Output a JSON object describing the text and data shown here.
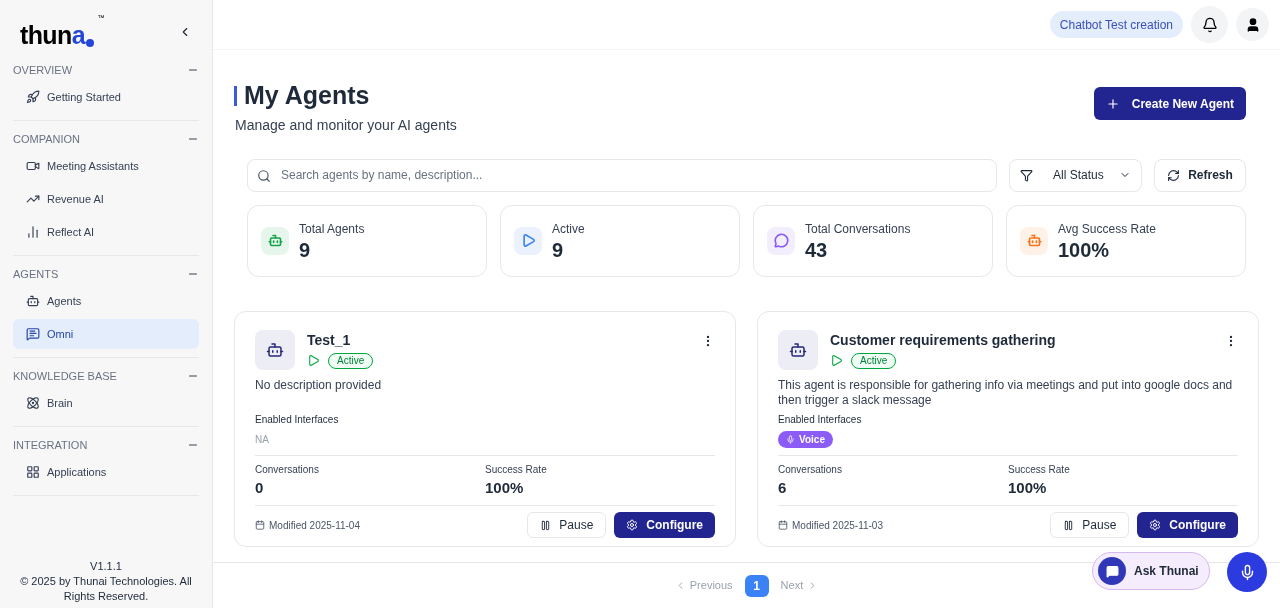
{
  "sidebar": {
    "logo": {
      "text": "thun",
      "accent": "a",
      "tm": "™"
    },
    "sections": [
      {
        "title": "OVERVIEW",
        "items": [
          {
            "label": "Getting Started",
            "kind": "rocket",
            "selected": false
          }
        ]
      },
      {
        "title": "COMPANION",
        "items": [
          {
            "label": "Meeting Assistants",
            "kind": "video",
            "selected": false
          },
          {
            "label": "Revenue AI",
            "kind": "trend",
            "selected": false
          },
          {
            "label": "Reflect AI",
            "kind": "chart",
            "selected": false
          }
        ]
      },
      {
        "title": "AGENTS",
        "items": [
          {
            "label": "Agents",
            "kind": "bot",
            "selected": false
          },
          {
            "label": "Omni",
            "kind": "message",
            "selected": true
          }
        ]
      },
      {
        "title": "KNOWLEDGE BASE",
        "items": [
          {
            "label": "Brain",
            "kind": "atom",
            "selected": false
          }
        ]
      },
      {
        "title": "INTEGRATION",
        "items": [
          {
            "label": "Applications",
            "kind": "apps",
            "selected": false
          }
        ]
      }
    ],
    "version": "V1.1.1",
    "copyright": "© 2025 by Thunai Technologies. All Rights Reserved."
  },
  "header": {
    "workspace": "Chatbot Test creation"
  },
  "page": {
    "title": "My Agents",
    "subtitle": "Manage and monitor your AI agents",
    "create_button": "Create New Agent"
  },
  "toolbar": {
    "search_placeholder": "Search agents by name, description...",
    "status_filter": "All Status",
    "refresh": "Refresh"
  },
  "stats": [
    {
      "label": "Total Agents",
      "value": "9",
      "kind": "bot",
      "color": "#16a34a"
    },
    {
      "label": "Active",
      "value": "9",
      "kind": "play",
      "color": "#3b82f6"
    },
    {
      "label": "Total Conversations",
      "value": "43",
      "kind": "chat",
      "color": "#8b5cf6"
    },
    {
      "label": "Avg Success Rate",
      "value": "100%",
      "kind": "bot",
      "color": "#f97316"
    }
  ],
  "agents": [
    {
      "name": "Test_1",
      "status": "Active",
      "description": "No description provided",
      "interfaces_label": "Enabled Interfaces",
      "interfaces_empty": "NA",
      "conversations_label": "Conversations",
      "conversations": "0",
      "success_label": "Success Rate",
      "success": "100%",
      "modified": "Modified 2025-11-04",
      "pause": "Pause",
      "configure": "Configure"
    },
    {
      "name": "Customer requirements gathering",
      "status": "Active",
      "description": "This agent is responsible for gathering info via meetings and put into google docs and then trigger a slack message",
      "interfaces_label": "Enabled Interfaces",
      "interfaces": [
        "Voice"
      ],
      "conversations_label": "Conversations",
      "conversations": "6",
      "success_label": "Success Rate",
      "success": "100%",
      "modified": "Modified 2025-11-03",
      "pause": "Pause",
      "configure": "Configure"
    }
  ],
  "pagination": {
    "previous": "Previous",
    "pages": [
      {
        "label": "1",
        "selected": true
      }
    ],
    "next": "Next"
  },
  "assistant": {
    "label": "Ask Thunai"
  }
}
